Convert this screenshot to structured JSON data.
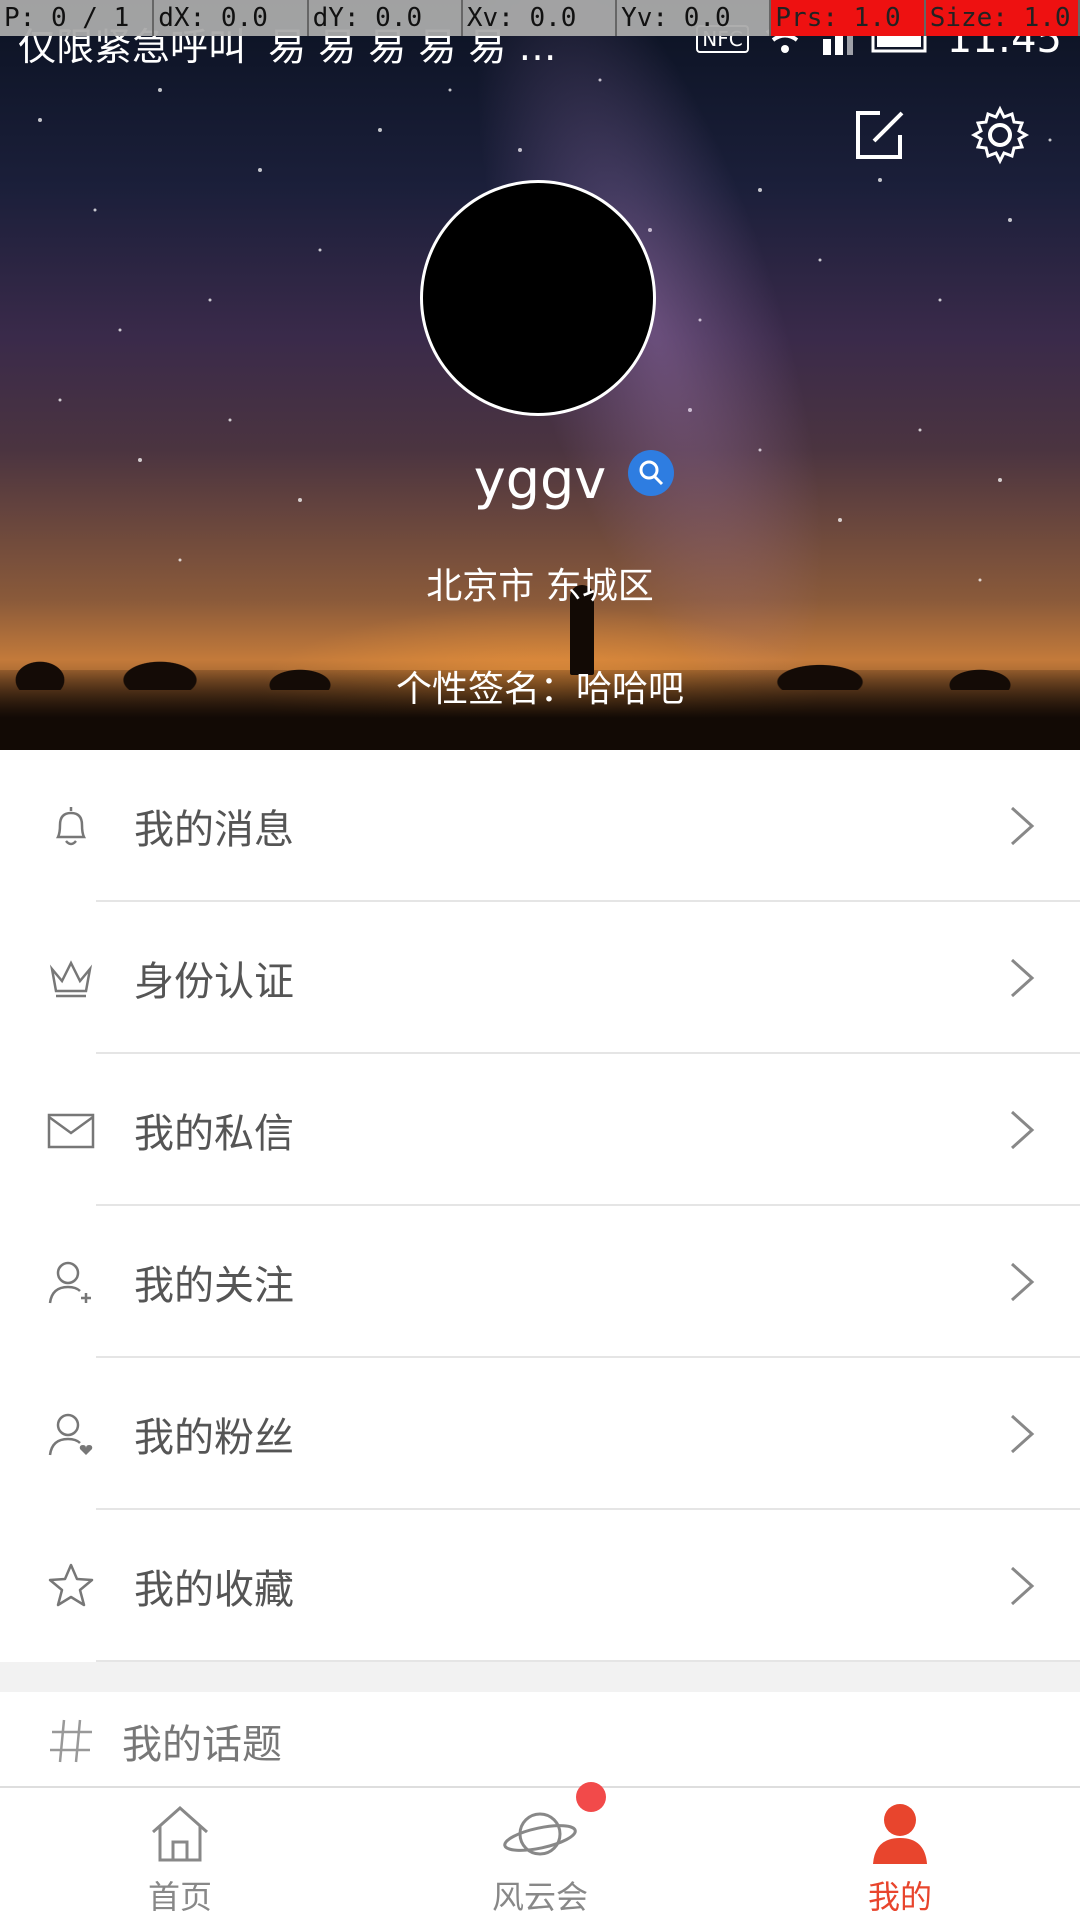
{
  "debug_bar": {
    "p": "P: 0 / 1",
    "dx": "dX: 0.0",
    "dy": "dY: 0.0",
    "xv": "Xv: 0.0",
    "yv": "Yv: 0.0",
    "prs": "Prs: 1.0",
    "size": "Size: 1.0"
  },
  "status_bar": {
    "carrier_text": "仅限紧急呼叫",
    "notification_icons": "易 易 易 易 易 …",
    "nfc": "NFC",
    "time": "11:45"
  },
  "profile": {
    "username": "yggv",
    "location": "北京市 东城区",
    "signature_label": "个性签名：",
    "signature_text": "哈哈吧"
  },
  "menu": {
    "items": [
      {
        "label": "我的消息",
        "icon": "bell-icon"
      },
      {
        "label": "身份认证",
        "icon": "crown-icon"
      },
      {
        "label": "我的私信",
        "icon": "mail-icon"
      },
      {
        "label": "我的关注",
        "icon": "user-follow-icon"
      },
      {
        "label": "我的粉丝",
        "icon": "user-fans-icon"
      },
      {
        "label": "我的收藏",
        "icon": "star-icon"
      }
    ],
    "topic_label": "我的话题"
  },
  "tabbar": {
    "tabs": [
      {
        "label": "首页",
        "icon": "home-icon"
      },
      {
        "label": "风云会",
        "icon": "planet-icon",
        "badge": true
      },
      {
        "label": "我的",
        "icon": "profile-icon",
        "active": true
      }
    ]
  },
  "colors": {
    "accent": "#e8452d",
    "badge_blue": "#2e7de1",
    "notification_dot": "#f24a4a"
  }
}
